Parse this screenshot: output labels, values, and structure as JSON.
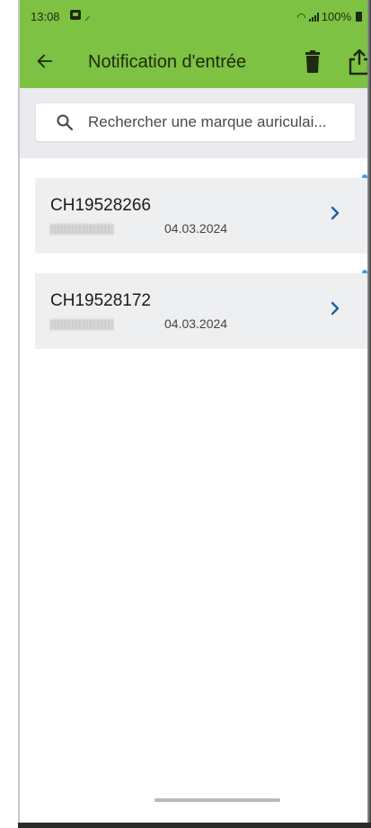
{
  "status": {
    "time": "13:08",
    "battery": "100%"
  },
  "appbar": {
    "title": "Notification d'entrée",
    "back_icon": "arrow-left-icon",
    "delete_icon": "trash-icon",
    "share_icon": "share-icon"
  },
  "search": {
    "placeholder": "Rechercher une marque auriculai..."
  },
  "items": [
    {
      "id": "CH19528266",
      "date": "04.03.2024"
    },
    {
      "id": "CH19528172",
      "date": "04.03.2024"
    }
  ],
  "colors": {
    "appbar": "#7dc242",
    "accent": "#1a5fa8",
    "dot": "#3ba3e6",
    "search_bg": "#e9ebee"
  }
}
